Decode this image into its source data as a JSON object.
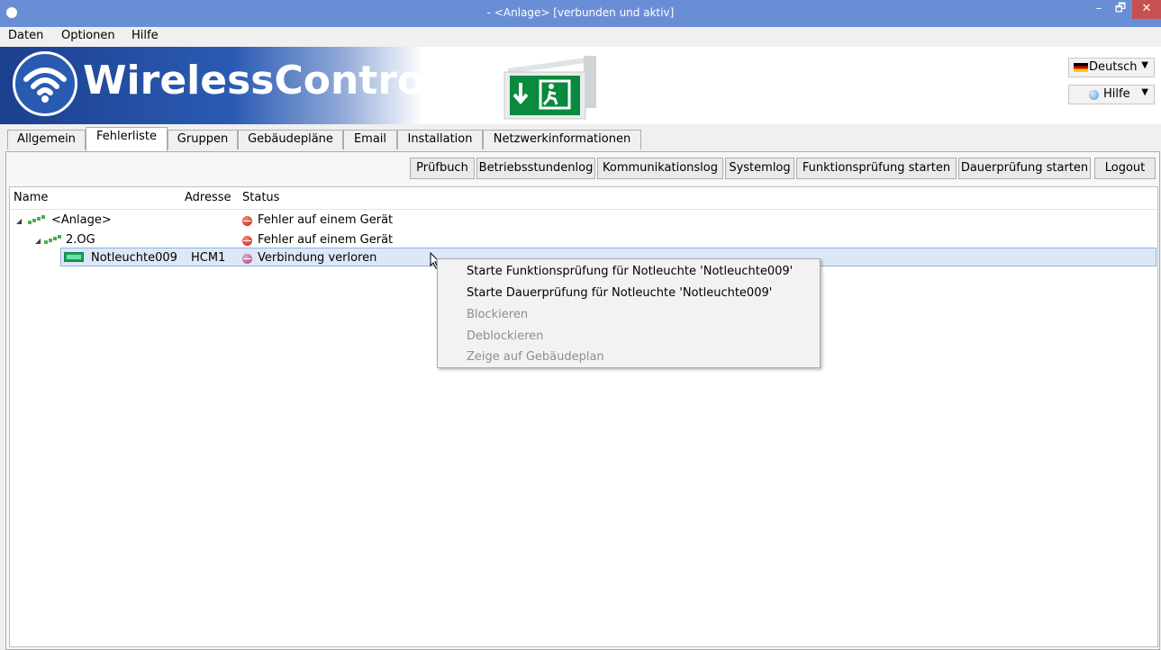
{
  "window": {
    "title": "- <Anlage> [verbunden und aktiv]",
    "minimize": "–",
    "maximize": "🗗",
    "close": "✕"
  },
  "menu": [
    "Daten",
    "Optionen",
    "Hilfe"
  ],
  "banner": {
    "logo_text": "WirelessControl",
    "language_label": "Deutsch",
    "help_label": "Hilfe"
  },
  "tabs": [
    "Allgemein",
    "Fehlerliste",
    "Gruppen",
    "Gebäudepläne",
    "Email",
    "Installation",
    "Netzwerkinformationen"
  ],
  "active_tab": "Fehlerliste",
  "toolbar": [
    "Prüfbuch",
    "Betriebsstundenlog",
    "Kommunikationslog",
    "Systemlog",
    "Funktionsprüfung starten",
    "Dauerprüfung starten",
    "Logout"
  ],
  "table": {
    "columns": [
      "Name",
      "Adresse",
      "Status"
    ],
    "rows": [
      {
        "name": "<Anlage>",
        "address": "",
        "status": "Fehler auf einem Gerät",
        "status_color": "#c0150a"
      },
      {
        "name": "2.OG",
        "address": "",
        "status": "Fehler auf einem Gerät",
        "status_color": "#c0150a"
      },
      {
        "name": "Notleuchte009",
        "address": "HCM1",
        "status": "Verbindung verloren",
        "status_color": "#a8366e"
      }
    ]
  },
  "context_menu": [
    {
      "label": "Starte Funktionsprüfung für Notleuchte 'Notleuchte009'",
      "enabled": true
    },
    {
      "label": "Starte Dauerprüfung für Notleuchte 'Notleuchte009'",
      "enabled": true
    },
    {
      "label": "Blockieren",
      "enabled": false
    },
    {
      "label": "Deblockieren",
      "enabled": false
    },
    {
      "label": "Zeige auf Gebäudeplan",
      "enabled": false
    }
  ]
}
